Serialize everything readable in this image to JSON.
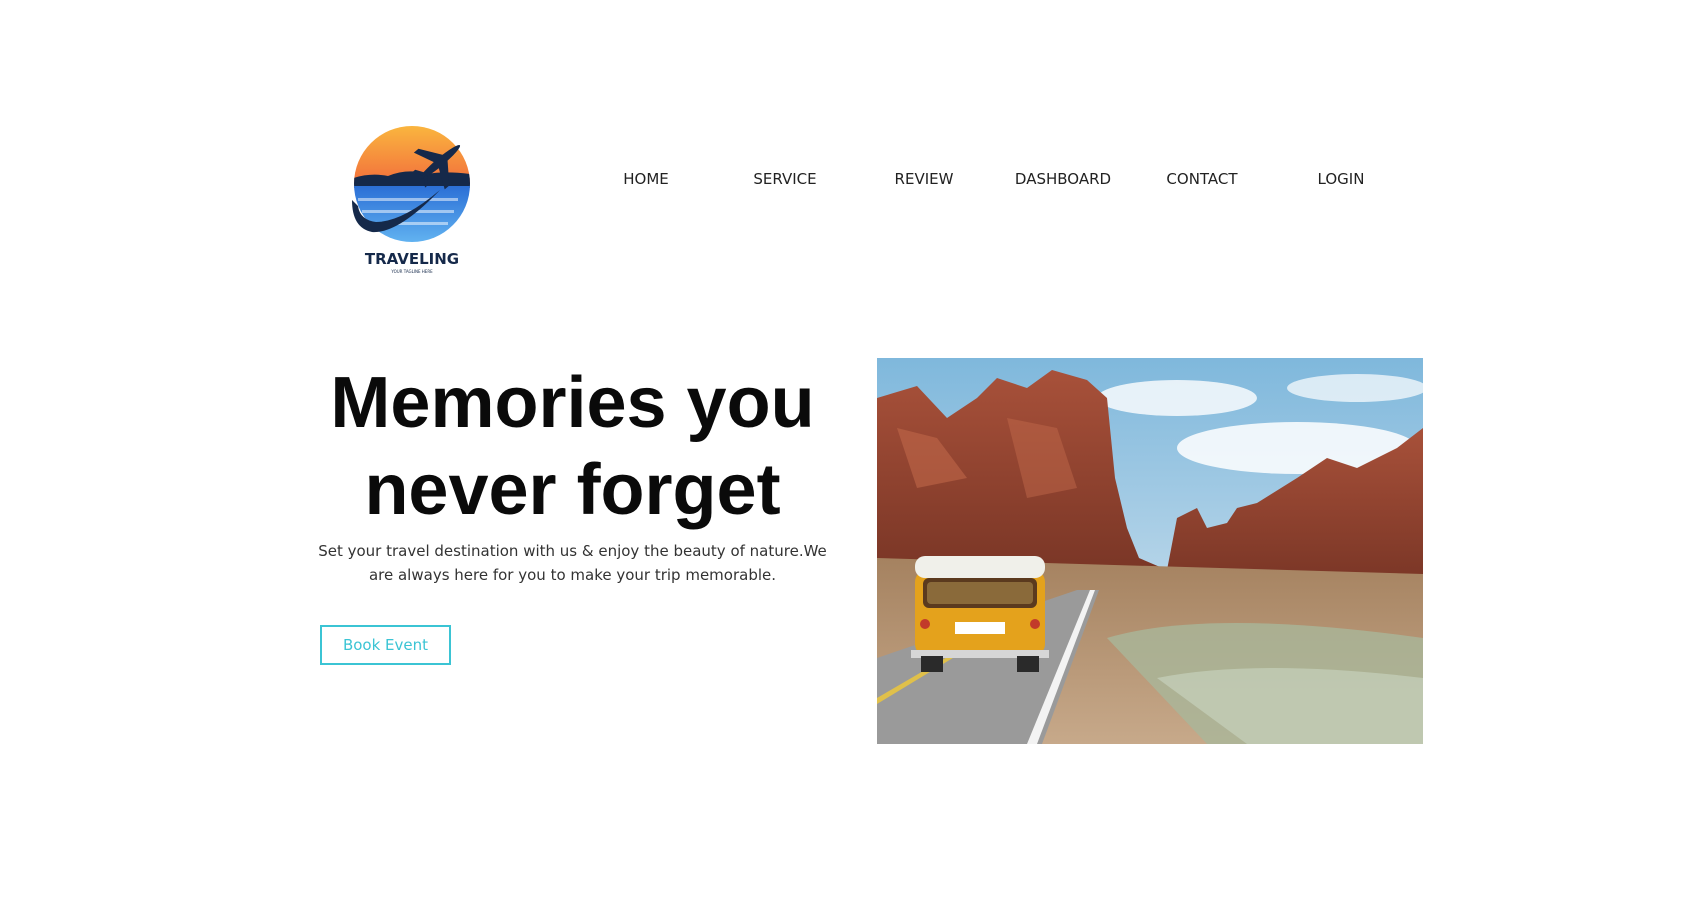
{
  "brand": {
    "name": "TRAVELING",
    "tagline": "YOUR TAGLINE HERE",
    "logo_icon": "plane-sunset-logo"
  },
  "nav": {
    "items": [
      {
        "label": "HOME"
      },
      {
        "label": "SERVICE"
      },
      {
        "label": "REVIEW"
      },
      {
        "label": "DASHBOARD"
      },
      {
        "label": "CONTACT"
      },
      {
        "label": "LOGIN"
      }
    ]
  },
  "hero": {
    "title": "Memories you never forget",
    "description": "Set your travel destination with us & enjoy the beauty of nature.We are always here for you to make your trip memorable.",
    "button_label": "Book Event",
    "image_subject": "yellow van driving on desert road among red rock canyon"
  },
  "colors": {
    "accent": "#3bc4d4",
    "text": "#0a0a0a",
    "logo_dark": "#15294a",
    "sunset_orange": "#f7a13a",
    "sea_blue": "#3a8fe0"
  }
}
